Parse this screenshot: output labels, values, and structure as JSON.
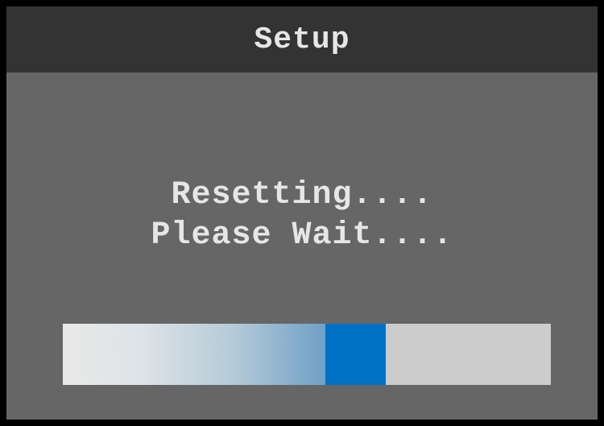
{
  "header": {
    "title": "Setup"
  },
  "status": {
    "line1": "Resetting....",
    "line2": "Please Wait...."
  },
  "progress": {
    "indicator_start_fraction": 0.538,
    "indicator_end_fraction": 0.662
  },
  "colors": {
    "title_bar": "#333333",
    "background": "#666666",
    "text": "#e6e6e6",
    "track": "#cccccc",
    "indicator": "#0072c6"
  }
}
